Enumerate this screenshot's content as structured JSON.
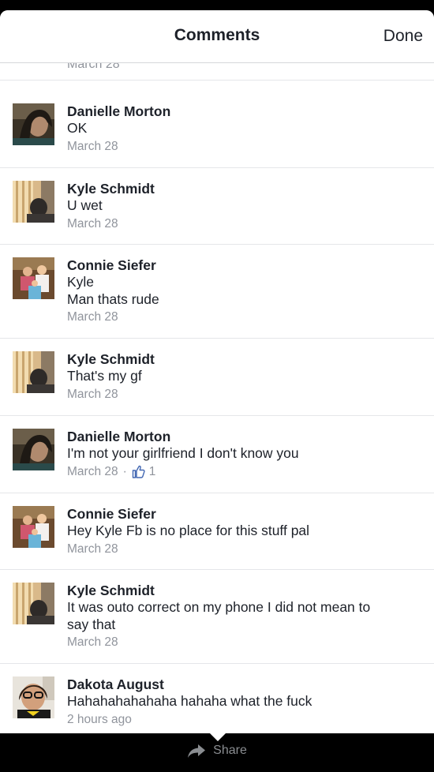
{
  "header": {
    "title": "Comments",
    "done_label": "Done"
  },
  "peek_date": "March 28",
  "comments": [
    {
      "name": "Danielle Morton",
      "lines": [
        "OK"
      ],
      "date": "March 28",
      "avatar": "danielle"
    },
    {
      "name": "Kyle Schmidt",
      "lines": [
        "U wet"
      ],
      "date": "March 28",
      "avatar": "kyle"
    },
    {
      "name": "Connie Siefer",
      "lines": [
        "Kyle",
        "Man thats rude"
      ],
      "date": "March 28",
      "avatar": "connie"
    },
    {
      "name": "Kyle Schmidt",
      "lines": [
        "That's my gf"
      ],
      "date": "March 28",
      "avatar": "kyle"
    },
    {
      "name": "Danielle Morton",
      "lines": [
        "I'm not your girlfriend I don't know you"
      ],
      "date": "March 28",
      "likes": "1",
      "avatar": "danielle"
    },
    {
      "name": "Connie Siefer",
      "lines": [
        "Hey Kyle Fb is no place for this stuff pal"
      ],
      "date": "March 28",
      "avatar": "connie"
    },
    {
      "name": "Kyle Schmidt",
      "lines": [
        "It was outo correct on my phone I did not mean to",
        "say that"
      ],
      "date": "March 28",
      "avatar": "kyle"
    },
    {
      "name": "Dakota August",
      "lines": [
        "Hahahahahahaha hahaha what the fuck"
      ],
      "date": "2 hours ago",
      "avatar": "dakota"
    }
  ],
  "bottom_bar": {
    "share_label": "Share"
  },
  "colors": {
    "text": "#1d2129",
    "meta": "#90949c",
    "like": "#4267b2",
    "divider": "#e5e6e9"
  }
}
